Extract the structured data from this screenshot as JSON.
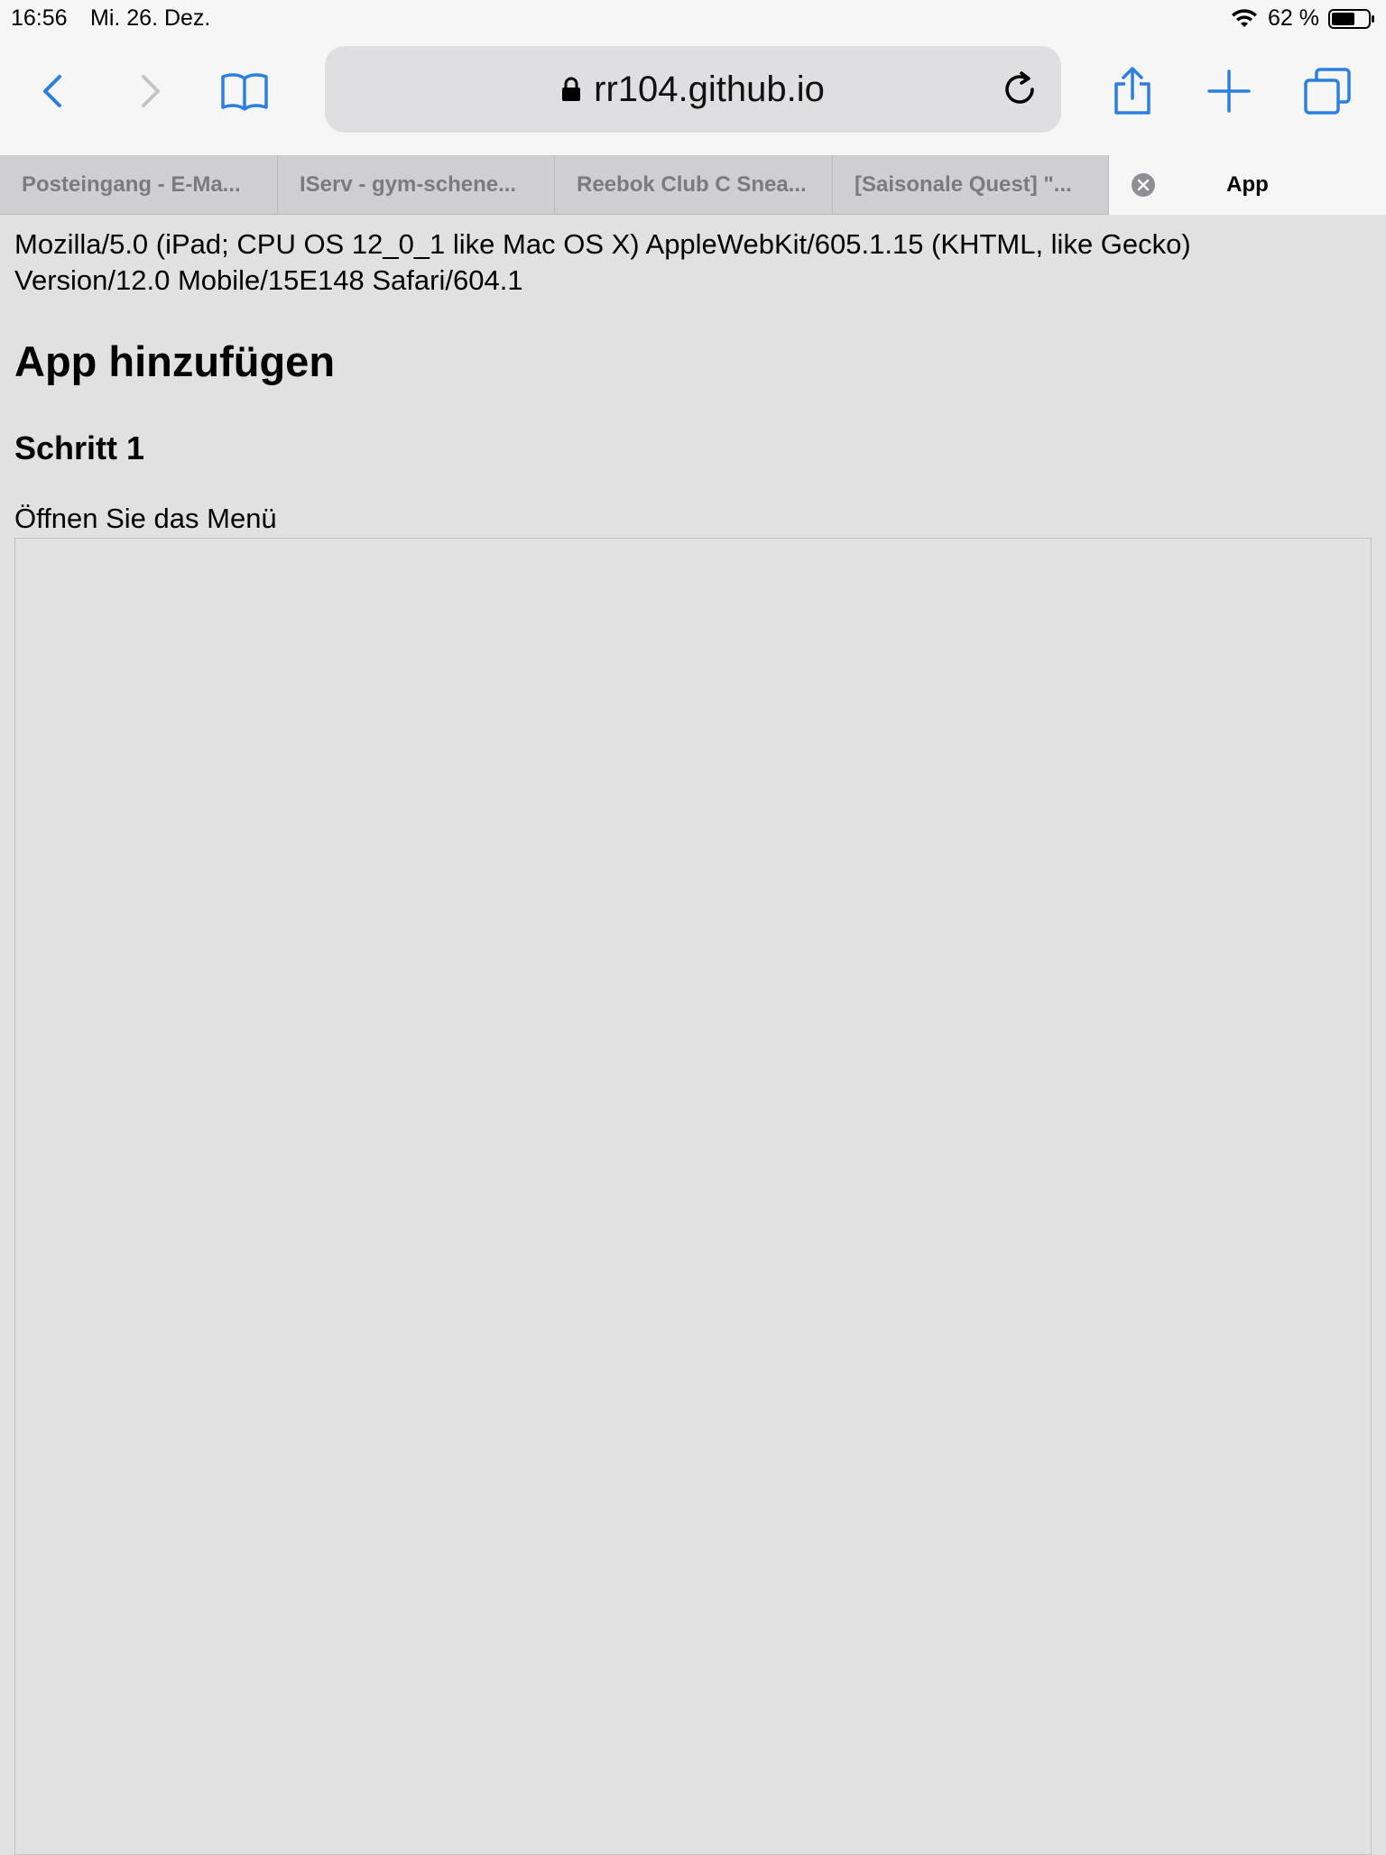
{
  "status_bar": {
    "time": "16:56",
    "date": "Mi. 26. Dez.",
    "battery": "62 %"
  },
  "toolbar": {
    "url": "rr104.github.io",
    "icons": {
      "back": "chevron-left-icon",
      "forward": "chevron-right-icon",
      "bookmarks": "open-book-icon",
      "lock": "lock-icon",
      "reload": "reload-icon",
      "share": "share-icon",
      "new_tab": "plus-icon",
      "tabs": "tabs-overview-icon"
    },
    "colors": {
      "accent": "#2b7fe0",
      "disabled": "#c4c4c6"
    }
  },
  "tabs": [
    {
      "label": "Posteingang - E-Ma...",
      "active": false
    },
    {
      "label": "IServ - gym-schene...",
      "active": false
    },
    {
      "label": "Reebok Club C Snea...",
      "active": false
    },
    {
      "label": "[Saisonale Quest] \"...",
      "active": false
    },
    {
      "label": "App",
      "active": true
    }
  ],
  "page": {
    "user_agent_line1": "Mozilla/5.0 (iPad; CPU OS 12_0_1 like Mac OS X) AppleWebKit/605.1.15 (KHTML, like Gecko)",
    "user_agent_line2": "Version/12.0 Mobile/15E148 Safari/604.1",
    "heading": "App hinzufügen",
    "step_heading": "Schritt 1",
    "step_text": "Öffnen Sie das Menü"
  }
}
